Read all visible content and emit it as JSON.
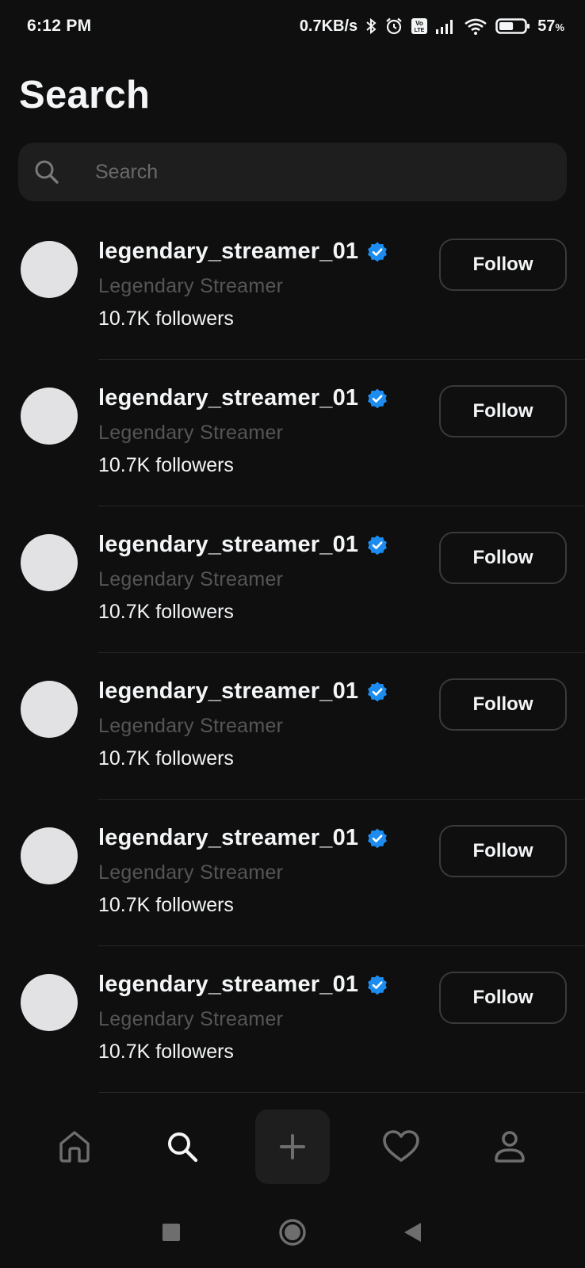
{
  "status_bar": {
    "time": "6:12 PM",
    "network_speed": "0.7KB/s",
    "battery_percent": "57",
    "battery_unit": "%",
    "battery_level": 0.57,
    "icons": [
      "bluetooth-icon",
      "alarm-icon",
      "volte-icon",
      "signal-icon",
      "wifi-icon",
      "battery-icon"
    ]
  },
  "page": {
    "title": "Search"
  },
  "search": {
    "placeholder": "Search",
    "value": ""
  },
  "results": [
    {
      "username": "legendary_streamer_01",
      "verified": true,
      "display_name": "Legendary Streamer",
      "followers": "10.7K followers",
      "follow_label": "Follow"
    },
    {
      "username": "legendary_streamer_01",
      "verified": true,
      "display_name": "Legendary Streamer",
      "followers": "10.7K followers",
      "follow_label": "Follow"
    },
    {
      "username": "legendary_streamer_01",
      "verified": true,
      "display_name": "Legendary Streamer",
      "followers": "10.7K followers",
      "follow_label": "Follow"
    },
    {
      "username": "legendary_streamer_01",
      "verified": true,
      "display_name": "Legendary Streamer",
      "followers": "10.7K followers",
      "follow_label": "Follow"
    },
    {
      "username": "legendary_streamer_01",
      "verified": true,
      "display_name": "Legendary Streamer",
      "followers": "10.7K followers",
      "follow_label": "Follow"
    },
    {
      "username": "legendary_streamer_01",
      "verified": true,
      "display_name": "Legendary Streamer",
      "followers": "10.7K followers",
      "follow_label": "Follow"
    }
  ],
  "bottom_nav": {
    "items": [
      {
        "icon": "home-icon",
        "active": false
      },
      {
        "icon": "search-icon",
        "active": true
      },
      {
        "icon": "plus-icon",
        "active": false
      },
      {
        "icon": "heart-icon",
        "active": false
      },
      {
        "icon": "profile-icon",
        "active": false
      }
    ]
  },
  "system_nav": {
    "items": [
      "recents-icon",
      "home-icon",
      "back-icon"
    ]
  },
  "colors": {
    "background": "#0f0f0f",
    "surface": "#1e1e1e",
    "text_primary": "#f3f5f7",
    "text_secondary": "#555555",
    "verified_blue": "#1d8cf0",
    "button_border": "#3a3a3a",
    "avatar_placeholder": "#e2e2e4"
  }
}
